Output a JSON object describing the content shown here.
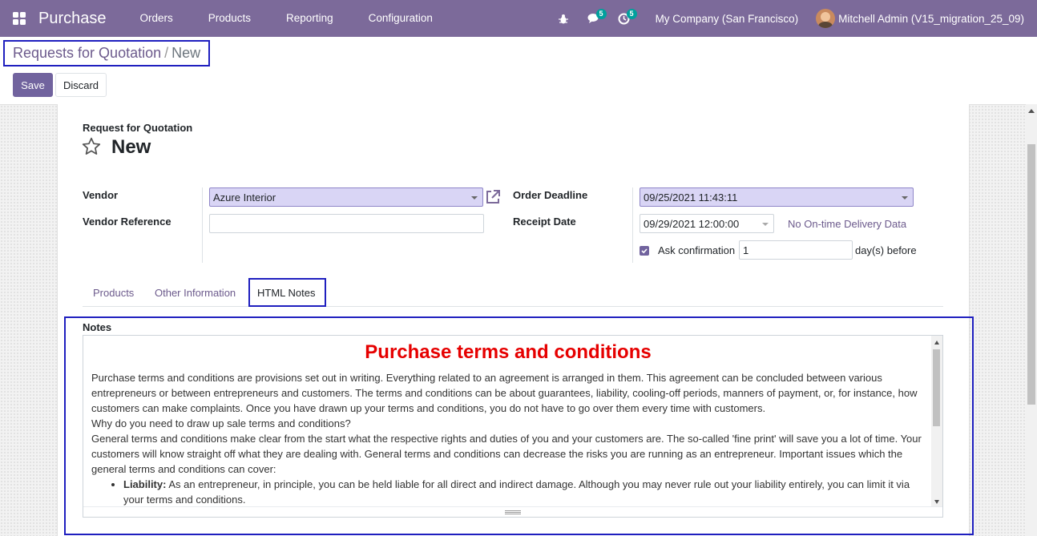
{
  "navbar": {
    "brand": "Purchase",
    "menu": [
      "Orders",
      "Products",
      "Reporting",
      "Configuration"
    ],
    "messages_badge": "5",
    "activities_badge": "5",
    "company": "My Company (San Francisco)",
    "user": "Mitchell Admin (V15_migration_25_09)"
  },
  "breadcrumb": {
    "parent": "Requests for Quotation",
    "separator": "/",
    "current": "New"
  },
  "buttons": {
    "save": "Save",
    "discard": "Discard"
  },
  "form": {
    "subtitle": "Request for Quotation",
    "title": "New",
    "vendor_label": "Vendor",
    "vendor_value": "Azure Interior",
    "vendor_reference_label": "Vendor Reference",
    "vendor_reference_value": "",
    "order_deadline_label": "Order Deadline",
    "order_deadline_value": "09/25/2021 11:43:11",
    "receipt_date_label": "Receipt Date",
    "receipt_date_value": "09/29/2021 12:00:00",
    "on_time_link": "No On-time Delivery Data",
    "ask_confirmation_label": "Ask confirmation",
    "ask_confirmation_days": "1",
    "days_before": "day(s) before"
  },
  "tabs": [
    "Products",
    "Other Information",
    "HTML Notes"
  ],
  "notes": {
    "label": "Notes",
    "heading": "Purchase terms and conditions",
    "para1": "Purchase terms and conditions are provisions set out in writing. Everything related to an agreement is arranged in them. This agreement can be concluded between various entrepreneurs or between entrepreneurs and customers. The terms and conditions can be about guarantees, liability, cooling-off periods, manners of payment, or, for instance, how customers can make complaints. Once you have drawn up your terms and conditions, you do not have to go over them every time with customers.",
    "para2": "Why do you need to draw up sale terms and conditions?",
    "para3": "General terms and conditions make clear from the start what the respective rights and duties of you and your customers are. The so-called 'fine print' will save you a lot of time. Your customers will know straight off what they are dealing with. General terms and conditions can decrease the risks you are running as an entrepreneur. Important issues which the general terms and conditions can cover:",
    "bullet1_bold": "Liability:",
    "bullet1_text": " As an entrepreneur, in principle, you can be held liable for all direct and indirect damage. Although you may never rule out your liability entirely, you can limit it via your terms and conditions."
  },
  "colors": {
    "navbar": "#7c6a9a",
    "primary": "#71639e",
    "highlight_border": "#1f1fbf",
    "heading_red": "#e60000",
    "badge": "#00a09d"
  }
}
